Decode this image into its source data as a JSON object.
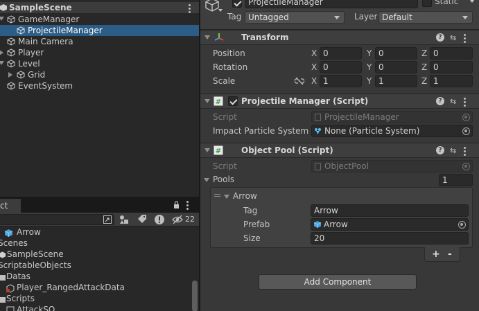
{
  "hierarchy": {
    "scene": "SampleScene",
    "items": [
      {
        "label": "GameManager"
      },
      {
        "label": "ProjectileManager"
      },
      {
        "label": "Main Camera"
      },
      {
        "label": "Player"
      },
      {
        "label": "Level"
      },
      {
        "label": "Grid"
      },
      {
        "label": "EventSystem"
      }
    ]
  },
  "project": {
    "tab": "ct",
    "hidden_count": "22",
    "items": [
      {
        "label": "Arrow"
      },
      {
        "label": "Scenes"
      },
      {
        "label": "SampleScene"
      },
      {
        "label": "ScriptableObjects"
      },
      {
        "label": "Datas"
      },
      {
        "label": "Player_RangedAttackData"
      },
      {
        "label": "Scripts"
      },
      {
        "label": "AttackSO"
      }
    ]
  },
  "inspector": {
    "object_name": "ProjectileManager",
    "static_label": "Static",
    "tag_label": "Tag",
    "tag_value": "Untagged",
    "layer_label": "Layer",
    "layer_value": "Default",
    "transform": {
      "title": "Transform",
      "position_label": "Position",
      "rotation_label": "Rotation",
      "scale_label": "Scale",
      "axes": [
        "X",
        "Y",
        "Z"
      ],
      "position": [
        "0",
        "0",
        "0"
      ],
      "rotation": [
        "0",
        "0",
        "0"
      ],
      "scale": [
        "1",
        "1",
        "1"
      ]
    },
    "projectile_manager": {
      "title": "Projectile Manager (Script)",
      "script_label": "Script",
      "script_value": "ProjectileManager",
      "impact_label": "Impact Particle System",
      "impact_value": "None (Particle System)"
    },
    "object_pool": {
      "title": "Object Pool (Script)",
      "script_label": "Script",
      "script_value": "ObjectPool",
      "pools_label": "Pools",
      "pools_count": "1",
      "element_name": "Arrow",
      "tag_label": "Tag",
      "tag_value": "Arrow",
      "prefab_label": "Prefab",
      "prefab_value": "Arrow",
      "size_label": "Size",
      "size_value": "20",
      "plus": "+",
      "minus": "-"
    },
    "add_component": "Add Component"
  }
}
